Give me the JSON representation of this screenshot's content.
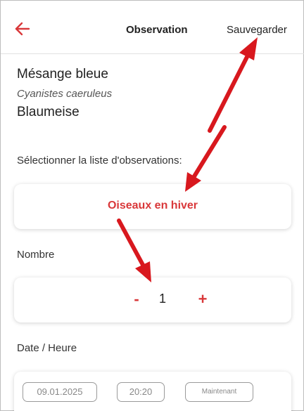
{
  "header": {
    "title": "Observation",
    "save_label": "Sauvegarder",
    "back_icon": "arrow-left-icon"
  },
  "species": {
    "common_name": "Mésange bleue",
    "latin_name": "Cyanistes caeruleus",
    "german_name": "Blaumeise"
  },
  "list_section": {
    "label": "Sélectionner la liste d'observations:",
    "selected_list": "Oiseaux en hiver"
  },
  "count_section": {
    "label": "Nombre",
    "minus_label": "-",
    "value": "1",
    "plus_label": "+"
  },
  "datetime_section": {
    "label": "Date / Heure",
    "date": "09.01.2025",
    "time": "20:20",
    "now_label": "Maintenant"
  },
  "colors": {
    "accent": "#d9383a",
    "annotation_arrow": "#d8181e"
  }
}
